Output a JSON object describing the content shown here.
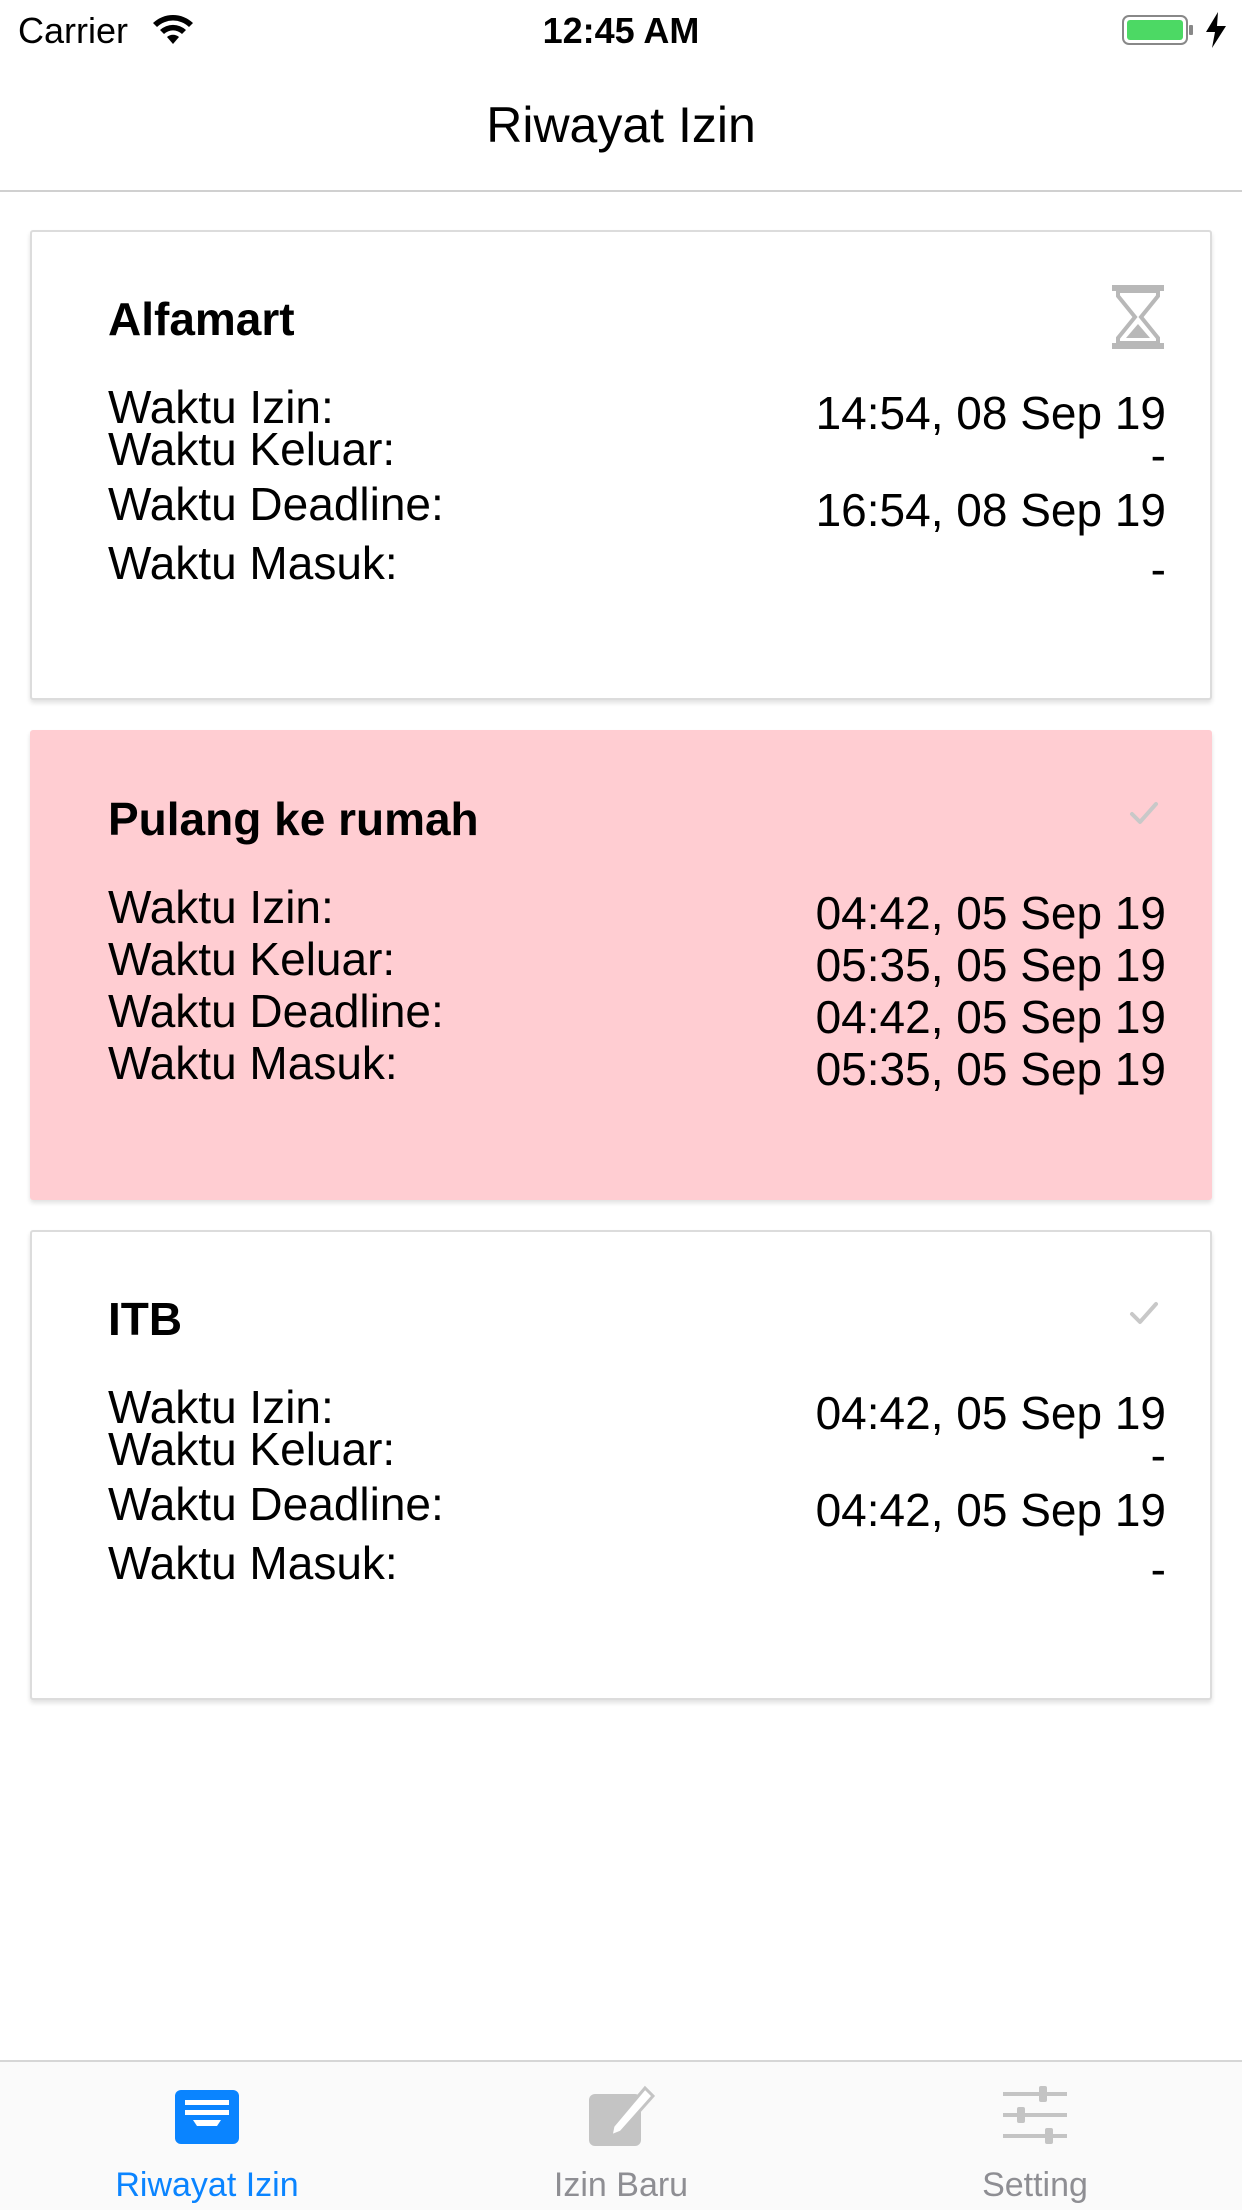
{
  "status_bar": {
    "carrier": "Carrier",
    "time": "12:45 AM"
  },
  "nav": {
    "title": "Riwayat Izin"
  },
  "cards": [
    {
      "title": "Alfamart",
      "status_icon": "hourglass-icon",
      "highlight": false,
      "rows": [
        {
          "label": "Waktu Izin:",
          "value": "14:54, 08 Sep 19"
        },
        {
          "label": "Waktu Keluar:",
          "value": "-"
        },
        {
          "label": "Waktu Deadline:",
          "value": "16:54, 08 Sep 19"
        },
        {
          "label": "Waktu Masuk:",
          "value": "-"
        }
      ]
    },
    {
      "title": "Pulang ke rumah",
      "status_icon": "checkmark-icon",
      "highlight": true,
      "rows": [
        {
          "label": "Waktu Izin:",
          "value": "04:42, 05 Sep 19"
        },
        {
          "label": "Waktu Keluar:",
          "value": "05:35, 05 Sep 19"
        },
        {
          "label": "Waktu Deadline:",
          "value": "04:42, 05 Sep 19"
        },
        {
          "label": "Waktu Masuk:",
          "value": "05:35, 05 Sep 19"
        }
      ]
    },
    {
      "title": "ITB",
      "status_icon": "checkmark-icon",
      "highlight": false,
      "rows": [
        {
          "label": "Waktu Izin:",
          "value": "04:42, 05 Sep 19"
        },
        {
          "label": "Waktu Keluar:",
          "value": "-"
        },
        {
          "label": "Waktu Deadline:",
          "value": "04:42, 05 Sep 19"
        },
        {
          "label": "Waktu Masuk:",
          "value": "-"
        }
      ]
    }
  ],
  "tabs": [
    {
      "label": "Riwayat Izin",
      "icon": "inbox-icon",
      "active": true
    },
    {
      "label": "Izin Baru",
      "icon": "compose-icon",
      "active": false
    },
    {
      "label": "Setting",
      "icon": "sliders-icon",
      "active": false
    }
  ],
  "colors": {
    "accent": "#0a84ff",
    "highlight_card": "#ffcdd2",
    "inactive_tab": "#8e8e93",
    "battery": "#4cd964"
  }
}
